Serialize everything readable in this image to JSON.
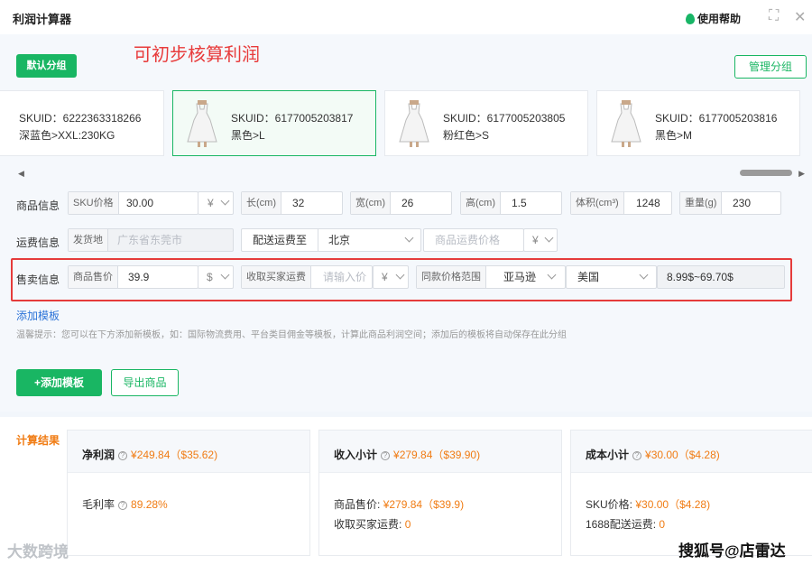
{
  "app": {
    "title": "利润计算器",
    "help": "使用帮助"
  },
  "annotation": "可初步核算利润",
  "groups": {
    "default": "默认分组",
    "manage": "管理分组"
  },
  "skus": [
    {
      "id": "SKUID：6222363318266",
      "variant": "深蓝色>XXL:230KG",
      "has_image": false
    },
    {
      "id": "SKUID：6177005203817",
      "variant": "黑色>L",
      "has_image": true,
      "active": true
    },
    {
      "id": "SKUID：6177005203805",
      "variant": "粉红色>S",
      "has_image": true
    },
    {
      "id": "SKUID：6177005203816",
      "variant": "黑色>M",
      "has_image": true
    }
  ],
  "product_info": {
    "label": "商品信息",
    "sku_price_label": "SKU价格",
    "sku_price": "30.00",
    "sku_currency": "¥",
    "length_label": "长(cm)",
    "length": "32",
    "width_label": "宽(cm)",
    "width": "26",
    "height_label": "高(cm)",
    "height": "1.5",
    "volume_label": "体积(cm³)",
    "volume": "1248",
    "weight_label": "重量(g)",
    "weight": "230"
  },
  "shipping_info": {
    "label": "运费信息",
    "origin_label": "发货地",
    "origin_placeholder": "广东省东莞市",
    "dest_label": "配送运费至",
    "dest": "北京",
    "fee_placeholder": "商品运费价格",
    "fee_currency": "¥"
  },
  "sales_info": {
    "label": "售卖信息",
    "price_label": "商品售价",
    "price": "39.9",
    "price_currency": "$",
    "buyer_fee_label": "收取买家运费",
    "buyer_fee_placeholder": "请输入价",
    "buyer_fee_currency": "¥",
    "range_label": "同款价格范围",
    "platform": "亚马逊",
    "country": "美国",
    "range": "8.99$~69.70$"
  },
  "add_template_link": "添加模板",
  "tip": "温馨提示：您可以在下方添加新模板，如：国际物流费用、平台类目佣金等模板，计算此商品利润空间；添加后的模板将自动保存在此分组",
  "buttons": {
    "add_template": "+添加模板",
    "export": "导出商品"
  },
  "results": {
    "title": "计算结果",
    "profit": {
      "label": "净利润",
      "value": "¥249.84（$35.62)",
      "margin_label": "毛利率",
      "margin": "89.28%"
    },
    "income": {
      "label": "收入小计",
      "value": "¥279.84（$39.90)",
      "line1_label": "商品售价:",
      "line1_value": "¥279.84（$39.9)",
      "line2_label": "收取买家运费:",
      "line2_value": "0"
    },
    "cost": {
      "label": "成本小计",
      "value": "¥30.00（$4.28)",
      "line1_label": "SKU价格:",
      "line1_value": "¥30.00（$4.28)",
      "line2_label": "1688配送运费:",
      "line2_value": "0"
    }
  },
  "watermarks": {
    "left": "大数跨境",
    "right": "搜狐号@店雷达"
  },
  "colors": {
    "accent": "#19b663",
    "highlight": "#e53b3b",
    "value": "#f07c14",
    "link": "#2d74d8"
  }
}
